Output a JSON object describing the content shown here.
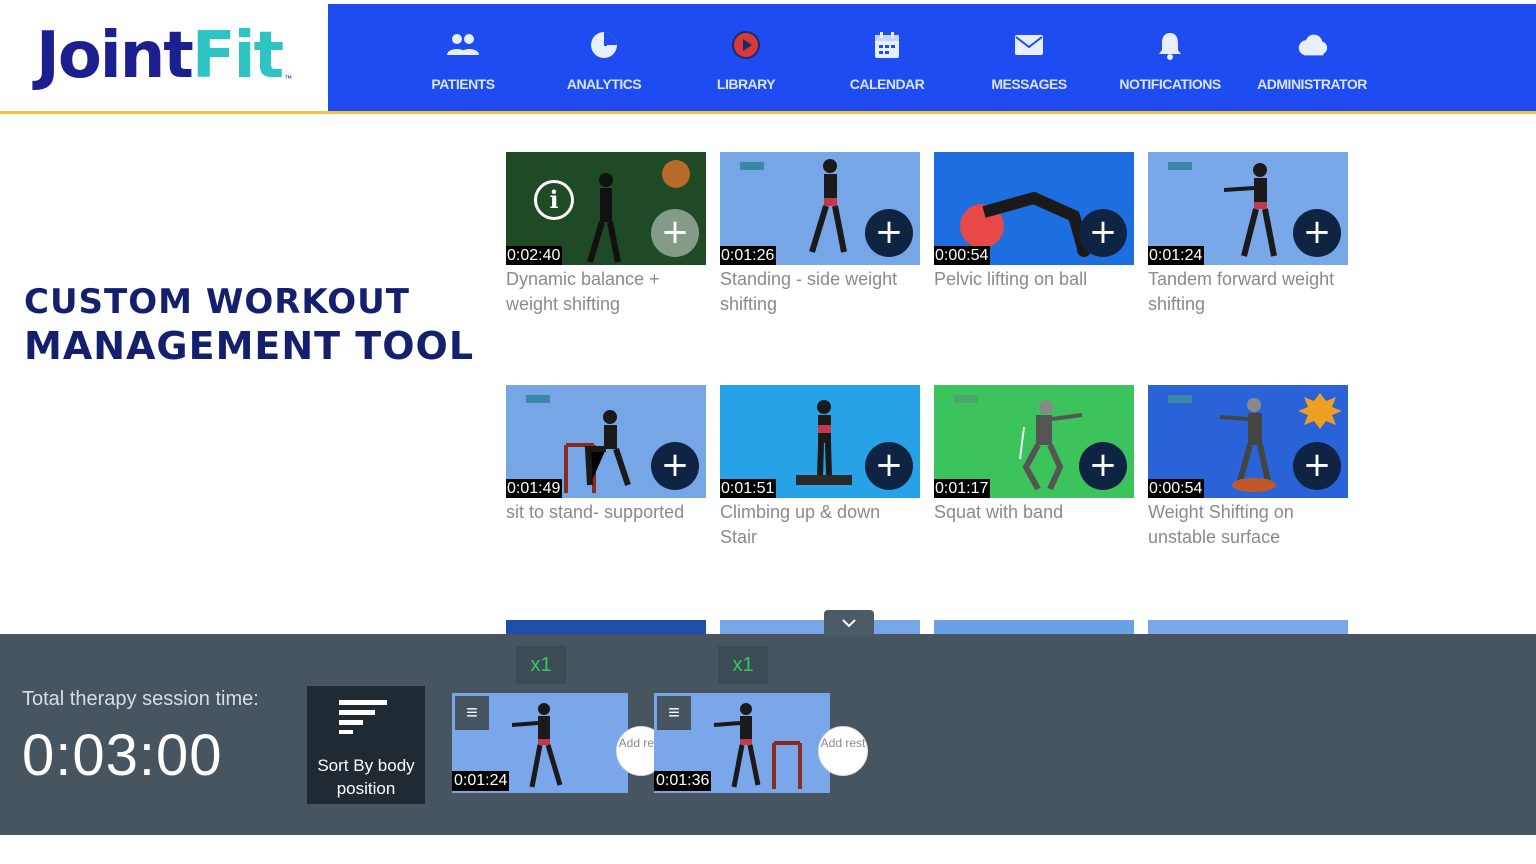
{
  "brand": {
    "part1": "Joint",
    "part2": "Fit",
    "tm": "™"
  },
  "nav": [
    {
      "label": "PATIENTS",
      "icon": "patients-icon"
    },
    {
      "label": "ANALYTICS",
      "icon": "pie-chart-icon"
    },
    {
      "label": "LIBRARY",
      "icon": "play-icon"
    },
    {
      "label": "CALENDAR",
      "icon": "calendar-icon"
    },
    {
      "label": "MESSAGES",
      "icon": "envelope-icon"
    },
    {
      "label": "NOTIFICATIONS",
      "icon": "bell-icon"
    },
    {
      "label": "ADMINISTRATOR",
      "icon": "cloud-icon"
    }
  ],
  "headline": {
    "line1": "CUSTOM WORKOUT",
    "line2": "MANAGEMENT TOOL"
  },
  "exercises": [
    {
      "duration": "0:02:40",
      "title": "Dynamic balance + weight shifting",
      "bg": "#1f4a26"
    },
    {
      "duration": "0:01:26",
      "title": "Standing - side weight shifting",
      "bg": "#77a6e6"
    },
    {
      "duration": "0:00:54",
      "title": "Pelvic lifting on ball",
      "bg": "#1d6fe0"
    },
    {
      "duration": "0:01:24",
      "title": "Tandem forward weight shifting",
      "bg": "#79a8e8"
    },
    {
      "duration": "0:01:49",
      "title": "sit to stand- supported",
      "bg": "#76a6e6"
    },
    {
      "duration": "0:01:51",
      "title": "Climbing up & down Stair",
      "bg": "#27a2e6"
    },
    {
      "duration": "0:01:17",
      "title": "Squat with band",
      "bg": "#3dc35c"
    },
    {
      "duration": "0:00:54",
      "title": "Weight Shifting on unstable surface",
      "bg": "#2a62d8"
    }
  ],
  "session": {
    "label": "Total therapy session time:",
    "time": "0:03:00",
    "sort_label": "Sort By body position",
    "items": [
      {
        "reps": "x1",
        "duration": "0:01:24",
        "rest": "Add rest"
      },
      {
        "reps": "x1",
        "duration": "0:01:36",
        "rest": "Add rest"
      }
    ]
  },
  "colors": {
    "nav_bg": "#1e4cf0",
    "brand_navy": "#1b1f8f",
    "brand_teal": "#2ec4c4",
    "bar_bg": "#46555f",
    "accent_gold": "#f5c242"
  }
}
